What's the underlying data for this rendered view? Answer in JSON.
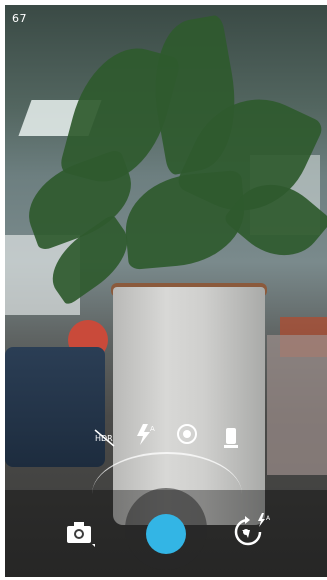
{
  "status": {
    "counter": "67"
  },
  "quick_settings": [
    {
      "name": "hdr-off-icon",
      "label": "HDR"
    },
    {
      "name": "flash-auto-icon",
      "label": "A"
    },
    {
      "name": "settings-icon",
      "label": ""
    },
    {
      "name": "scene-mode-icon",
      "label": ""
    }
  ],
  "bottom": {
    "mode_icon": "camera-mode-icon",
    "shutter_icon": "shutter-button",
    "switch_icon": "switch-camera-icon",
    "switch_flash_badge": "A"
  },
  "colors": {
    "shutter": "#33b5e5",
    "icon": "#ffffff"
  }
}
